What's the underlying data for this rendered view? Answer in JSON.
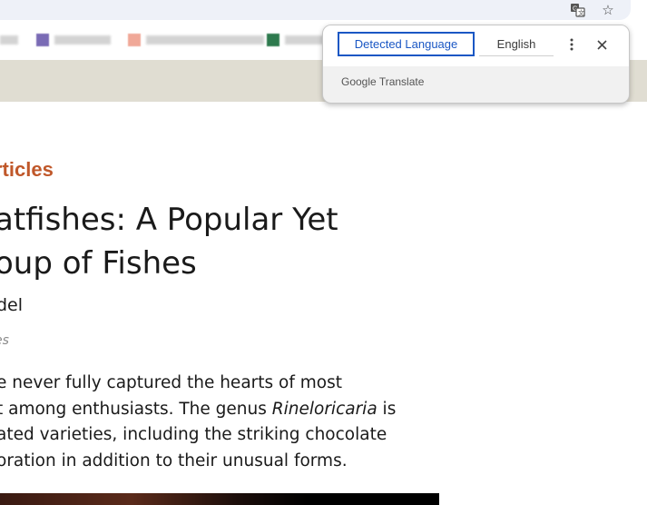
{
  "browser": {
    "translate_icon": "translate-icon",
    "star_icon": "star-icon"
  },
  "translate_popup": {
    "tab_detected": "Detected Language",
    "tab_target": "English",
    "brand": "Google Translate",
    "menu_icon": "more-vert-icon",
    "close_icon": "close-icon"
  },
  "article": {
    "category": "rticles",
    "title_lines": [
      "atfishes: A Popular Yet",
      "oup of Fishes"
    ],
    "author": "del",
    "meta": "es",
    "body_lines": [
      {
        "pre": "e never fully captured the hearts of most",
        "em": "",
        "post": ""
      },
      {
        "pre": "t among enthusiasts. The genus ",
        "em": "Rineloricaria",
        "post": " is"
      },
      {
        "pre": "ated varieties, including the striking chocolate",
        "em": "",
        "post": ""
      },
      {
        "pre": "oration in addition to their unusual forms.",
        "em": "",
        "post": ""
      }
    ]
  },
  "colors": {
    "accent_blue": "#1a57c4",
    "category_orange": "#c0582a",
    "header_band": "#e0ddd2"
  }
}
